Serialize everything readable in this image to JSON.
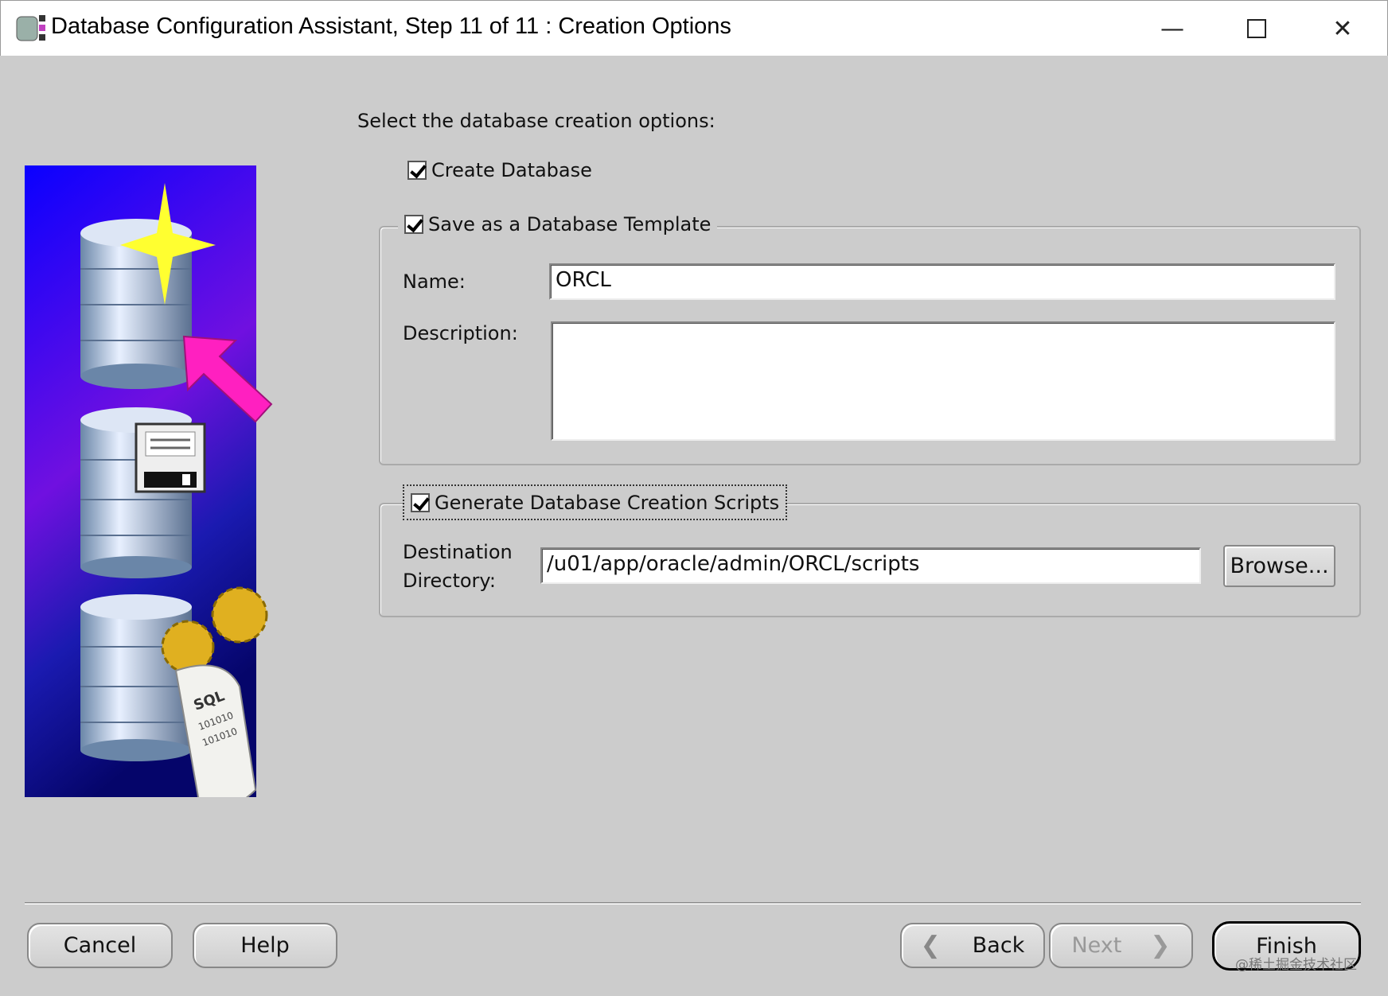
{
  "window": {
    "title": "Database Configuration Assistant, Step 11 of 11 : Creation Options",
    "controls": [
      "minimize",
      "maximize",
      "close"
    ]
  },
  "prompt": "Select the database creation options:",
  "create_database": {
    "label": "Create Database",
    "checked": true
  },
  "template": {
    "label": "Save as a Database Template",
    "checked": true,
    "name_label": "Name:",
    "name_value": "ORCL",
    "description_label": "Description:",
    "description_value": ""
  },
  "scripts": {
    "label": "Generate Database Creation Scripts",
    "checked": true,
    "dest_label_1": "Destination",
    "dest_label_2": "Directory:",
    "dest_value": "/u01/app/oracle/admin/ORCL/scripts",
    "browse_label": "Browse..."
  },
  "illustration": {
    "sql_text": "SQL",
    "binary_text": "101010"
  },
  "buttons": {
    "cancel": "Cancel",
    "help": "Help",
    "back": "Back",
    "next": "Next",
    "finish": "Finish",
    "next_enabled": false
  },
  "watermark": "@稀土掘金技术社区",
  "colors": {
    "panel_top": "#0000ff",
    "panel_bottom": "#0a0a80",
    "arrow": "#ff20c0"
  }
}
